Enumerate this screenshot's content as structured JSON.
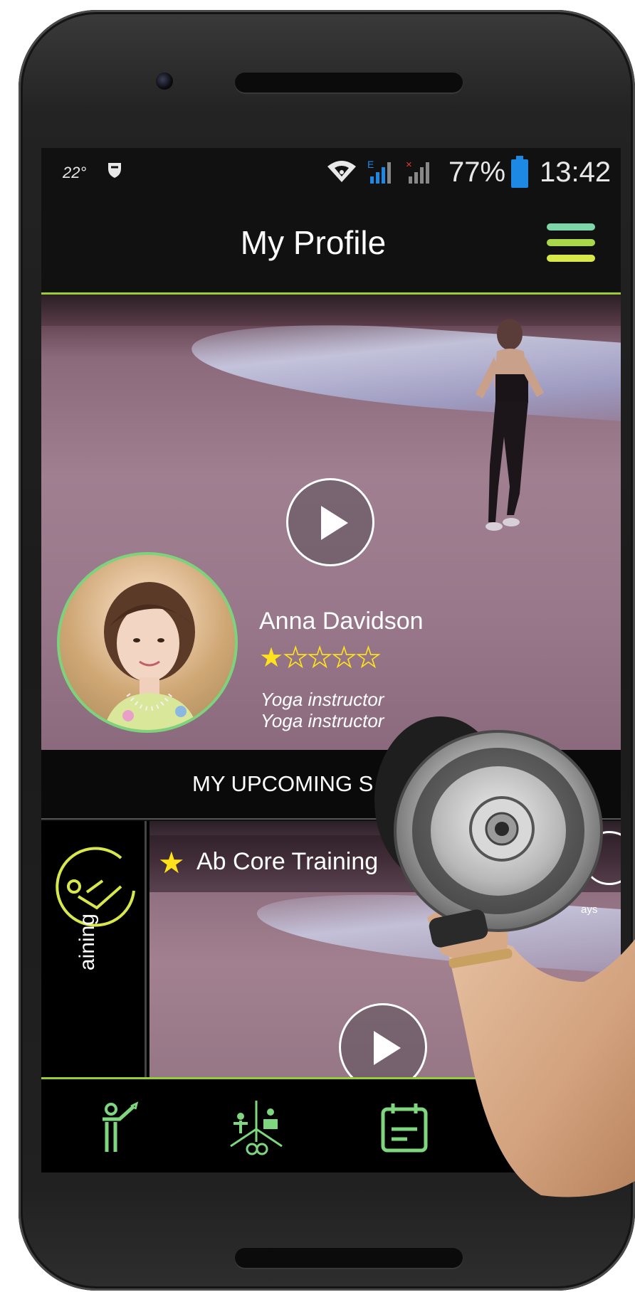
{
  "status_bar": {
    "temperature": "22°",
    "battery_percent": "77%",
    "time": "13:42",
    "network_label": "E"
  },
  "header": {
    "title": "My Profile"
  },
  "profile": {
    "name": "Anna Davidson",
    "rating": {
      "value": 1,
      "max": 5
    },
    "job_titles": [
      "Yoga instructor",
      "Yoga instructor"
    ]
  },
  "upcoming": {
    "title": "MY UPCOMING S",
    "session": {
      "side_label": "aining",
      "title": "Ab Core Training",
      "countdown_label": "ays"
    }
  },
  "colors": {
    "accent": "#9acd32",
    "star": "#ffe21c",
    "avatar_ring": "#7cd37c",
    "battery": "#1e88e5"
  },
  "icons": {
    "menu": "hamburger-menu-icon",
    "nav": [
      "trainer-icon",
      "activities-icon",
      "calendar-icon"
    ]
  }
}
